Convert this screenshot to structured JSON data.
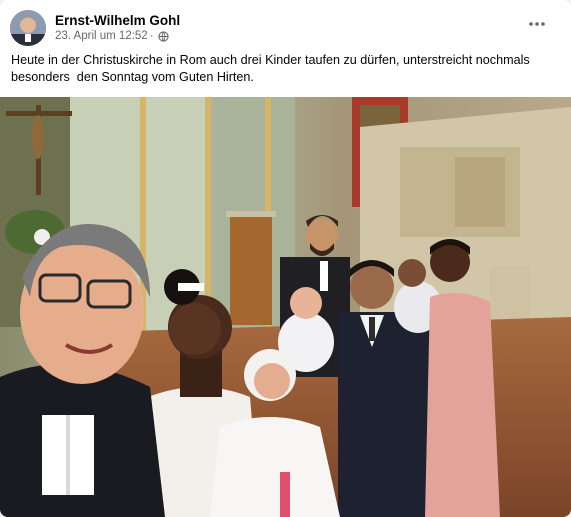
{
  "post": {
    "author": "Ernst-Wilhelm Gohl",
    "date": "23. April um 12:52",
    "separator": "·",
    "audience_icon": "globe-icon",
    "more_icon": "more-options-icon",
    "text": "Heute in der Christuskirche in Rom auch drei Kinder taufen zu dürfen, unterstreicht nochmals besonders  den Sonntag vom Guten Hirten."
  },
  "photo": {
    "description_icon": "group-selfie-photo"
  },
  "colors": {
    "name_text": "#050505",
    "meta_text": "#65676b",
    "card_bg": "#ffffff"
  }
}
